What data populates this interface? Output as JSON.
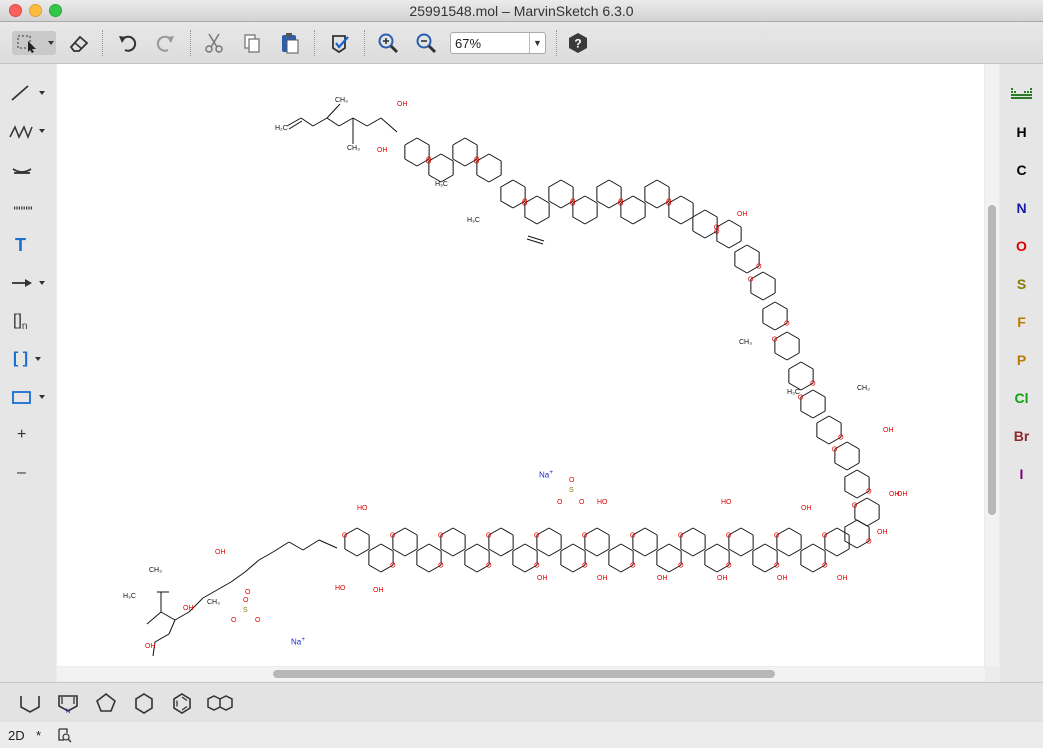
{
  "window": {
    "title": "25991548.mol – MarvinSketch 6.3.0"
  },
  "toolbar": {
    "buttons": [
      "select-tool",
      "erase-tool",
      "undo",
      "redo",
      "cut",
      "copy",
      "paste",
      "clean",
      "zoom-in",
      "zoom-out",
      "help"
    ],
    "zoom_value": "67%"
  },
  "left_toolbar": {
    "tools": [
      "single-bond",
      "chain",
      "bond-type",
      "dashed-bond",
      "text",
      "arrow",
      "repeat-bracket",
      "brackets",
      "rectangle",
      "increase-charge",
      "decrease-charge"
    ],
    "text_tool_label": "T",
    "repeat_label": "[]",
    "repeat_sub": "n",
    "brackets_label": "[ ]",
    "plus_label": "+",
    "minus_label": "–"
  },
  "right_toolbar": {
    "elements": [
      {
        "symbol": "H",
        "color": "#000000"
      },
      {
        "symbol": "C",
        "color": "#000000"
      },
      {
        "symbol": "N",
        "color": "#1a1aa8"
      },
      {
        "symbol": "O",
        "color": "#e00000"
      },
      {
        "symbol": "S",
        "color": "#8a7a00"
      },
      {
        "symbol": "F",
        "color": "#b87a00"
      },
      {
        "symbol": "P",
        "color": "#b87a00"
      },
      {
        "symbol": "Cl",
        "color": "#10a010"
      },
      {
        "symbol": "Br",
        "color": "#8a2a2a"
      },
      {
        "symbol": "I",
        "color": "#7a007a"
      }
    ]
  },
  "canvas": {
    "ions": [
      "Na",
      "Na"
    ],
    "charge": "+",
    "labels": {
      "h2c": "H₂C",
      "ch3": "CH₃",
      "h3c": "H₃C",
      "oh": "OH",
      "ho": "HO",
      "o": "O",
      "s": "S",
      "h": "H"
    }
  },
  "bottom_toolbar": {
    "templates": [
      "cyclopentane-open",
      "pyrrole",
      "cyclopentane",
      "cyclohexane",
      "benzene",
      "naphthalene"
    ]
  },
  "status": {
    "mode": "2D",
    "modified": "*"
  }
}
